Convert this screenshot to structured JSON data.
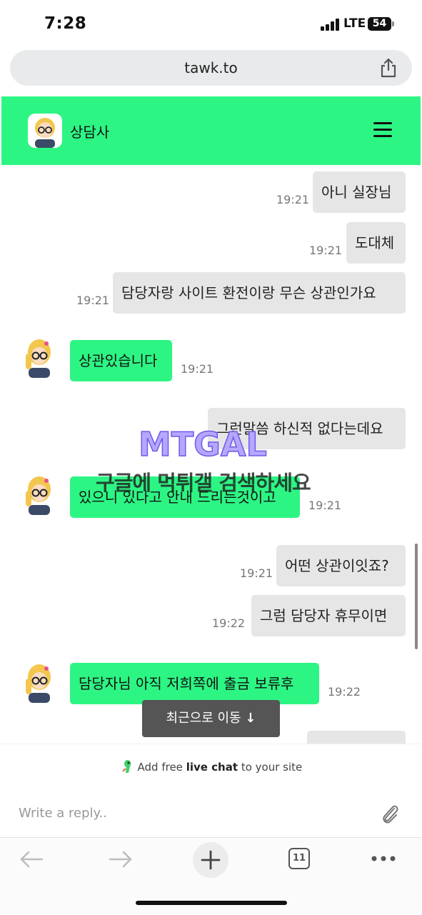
{
  "status_bar": {
    "time": "7:28",
    "network": "LTE",
    "battery": "54"
  },
  "browser": {
    "url": "tawk.to",
    "tab_count": "11"
  },
  "chat": {
    "agent_name": "상담사",
    "messages": [
      {
        "from": "visitor",
        "text": "아니 실장님",
        "time": "19:21"
      },
      {
        "from": "visitor",
        "text": "도대체",
        "time": "19:21"
      },
      {
        "from": "visitor",
        "text": "담당자랑 사이트 환전이랑 무슨 상관인가요",
        "time": "19:21"
      },
      {
        "from": "agent",
        "text": "상관있습니다",
        "time": "19:21"
      },
      {
        "from": "visitor",
        "text": "그런말씀 하신적 없다는데요",
        "time": ""
      },
      {
        "from": "agent",
        "text": "있으니 있다고 안내 드리는것이고",
        "time": "19:21"
      },
      {
        "from": "visitor",
        "text": "어떤 상관이잇죠?",
        "time": "19:21"
      },
      {
        "from": "visitor",
        "text": "그럼 담당자 휴무이면",
        "time": "19:22"
      },
      {
        "from": "agent",
        "text": "담당자님 아직 저희쪽에 출금 보류후",
        "time": "19:22"
      }
    ],
    "jump_label": "최근으로 이동",
    "powered": {
      "prefix": "Add free",
      "bold": "live chat",
      "suffix": "to your site"
    },
    "reply_placeholder": "Write a reply.."
  },
  "watermark": {
    "logo_text": "MTGAL",
    "caption": "구글에 먹튀갤 검색하세요"
  },
  "colors": {
    "accent": "#2df584",
    "visitor_bubble": "#e6e6e6",
    "toast": "#555555"
  }
}
